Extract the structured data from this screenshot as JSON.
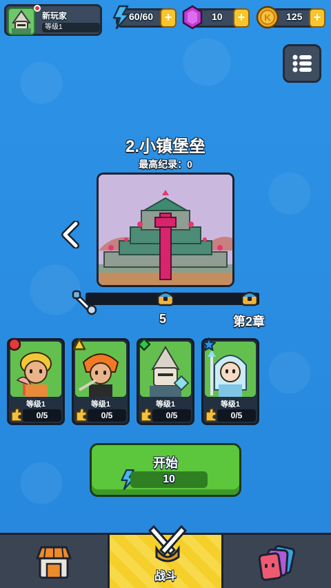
{
  "player": {
    "name": "新玩家",
    "level": "等级1",
    "xp_fraction": 0.0
  },
  "resources": {
    "energy": "60/60",
    "gems": "10",
    "coins": "125",
    "plus": "+"
  },
  "level": {
    "title": "2.小镇堡垒",
    "record": "最高纪录：0",
    "milestone_1": "5",
    "milestone_2": "第2章"
  },
  "heroes": [
    {
      "level": "等级1",
      "progress": "0/5",
      "gem_color": "#e53a3a",
      "gem_shape": "circle"
    },
    {
      "level": "等级1",
      "progress": "0/5",
      "gem_color": "#f5d22a",
      "gem_shape": "triangle"
    },
    {
      "level": "等级1",
      "progress": "0/5",
      "gem_color": "#35c24a",
      "gem_shape": "diamond"
    },
    {
      "level": "等级1",
      "progress": "0/5",
      "gem_color": "#2f8ee8",
      "gem_shape": "star"
    }
  ],
  "start": {
    "label": "开始",
    "cost": "10"
  },
  "nav": {
    "battle": "战斗",
    "shop_icon": "shop-icon",
    "battle_icon": "crossed-swords-icon",
    "cards_icon": "cards-icon"
  },
  "colors": {
    "background": "#2a8fe0",
    "accent_green": "#5cc73c",
    "accent_yellow": "#f5cf2a",
    "gem_purple": "#c33cd6",
    "coin_gold": "#f2a818"
  }
}
